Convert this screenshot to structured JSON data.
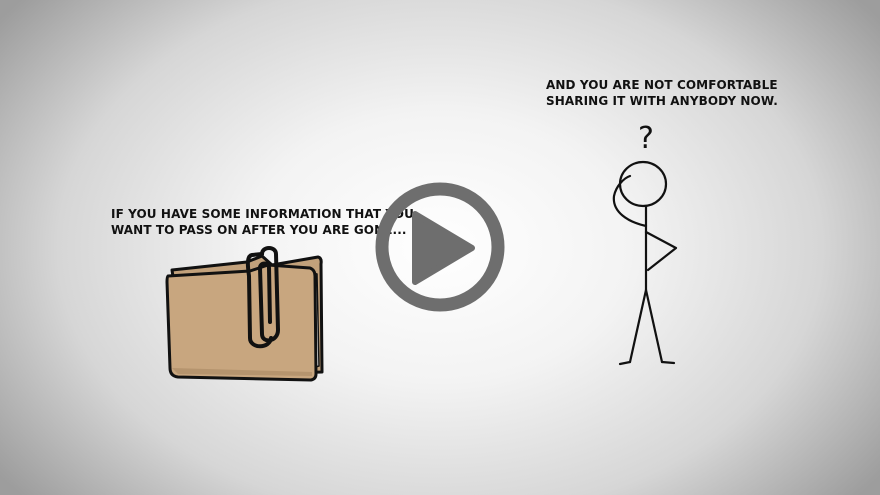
{
  "scene": {
    "left_caption": {
      "line1": "IF YOU HAVE SOME INFORMATION THAT YOU",
      "line2": "WANT TO PASS ON AFTER YOU ARE GONE..."
    },
    "right_caption": {
      "line1": "AND YOU ARE NOT COMFORTABLE",
      "line2": "SHARING IT WITH ANYBODY NOW."
    },
    "question_mark": "?",
    "folder_icon": "folder-with-paperclip",
    "figure_icon": "stick-figure-thinking"
  },
  "player": {
    "play_icon": "play-icon",
    "accent_color": "#6e6e6e"
  }
}
